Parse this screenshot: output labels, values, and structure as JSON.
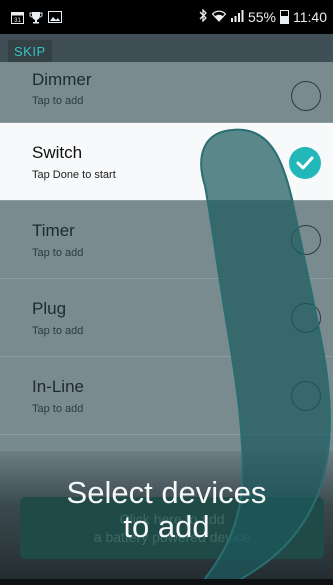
{
  "status_bar": {
    "left_icons": [
      "calendar-icon",
      "trophy-icon",
      "photo-icon"
    ],
    "right_icons": [
      "bluetooth-icon",
      "wifi-icon",
      "signal-icon",
      "battery-icon"
    ],
    "battery_percent": "55%",
    "time": "11:40"
  },
  "header": {
    "skip_label": "SKIP"
  },
  "devices": [
    {
      "name": "Dimmer",
      "subtitle": "Tap to add",
      "selected": false
    },
    {
      "name": "Switch",
      "subtitle": "Tap Done to start",
      "selected": true
    },
    {
      "name": "Timer",
      "subtitle": "Tap to add",
      "selected": false
    },
    {
      "name": "Plug",
      "subtitle": "Tap to add",
      "selected": false
    },
    {
      "name": "In-Line",
      "subtitle": "Tap to add",
      "selected": false
    }
  ],
  "add_battery": {
    "line1": "Click here to add",
    "line2": "a battery powered device"
  },
  "overlay": {
    "line1": "Select devices",
    "line2": "to add"
  },
  "colors": {
    "accent": "#22b8b9",
    "skip_text": "#36c2c4"
  }
}
